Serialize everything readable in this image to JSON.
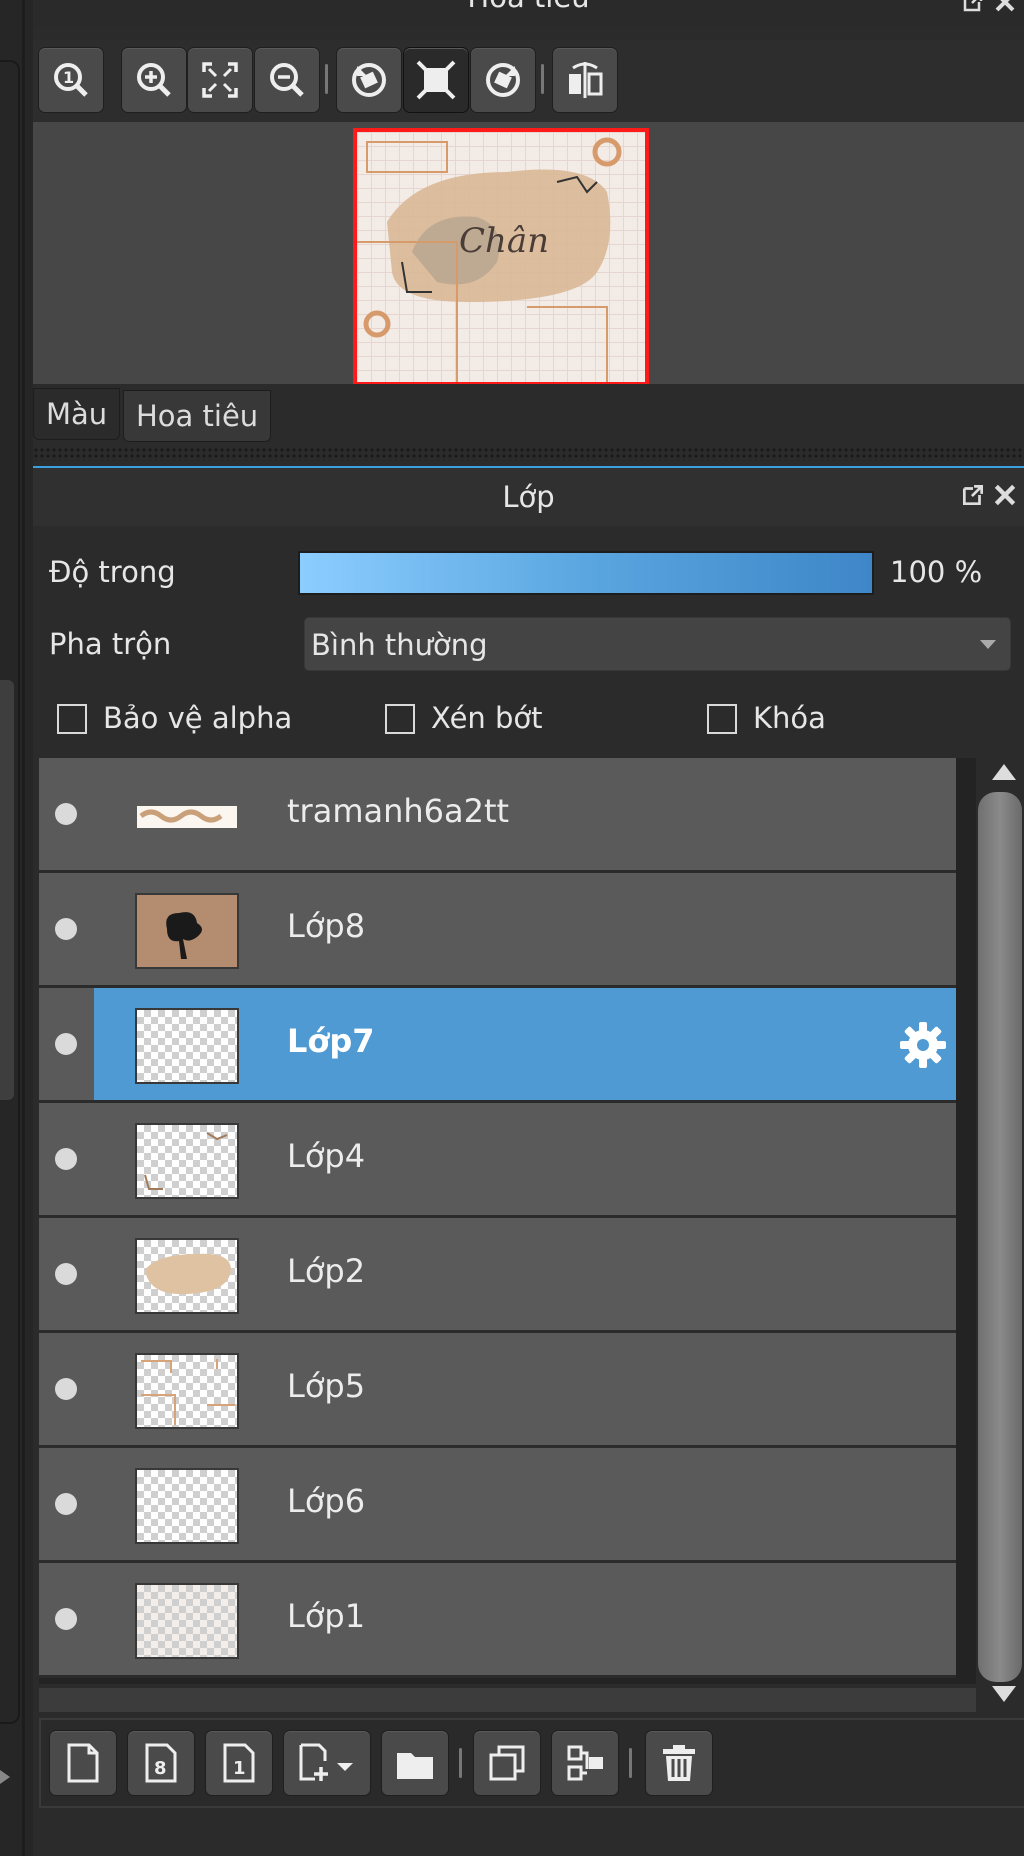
{
  "navigator": {
    "title": "Hoa tiêu",
    "tools": [
      "zoom-reset-icon",
      "zoom-in-icon",
      "fit-window-icon",
      "zoom-out-icon",
      "rotate-left-icon",
      "fit-canvas-icon",
      "rotate-right-icon",
      "flip-icon"
    ],
    "tabs": [
      {
        "label": "Màu"
      },
      {
        "label": "Hoa tiêu"
      }
    ],
    "active_tab": 1,
    "preview_text": "Chân"
  },
  "layers": {
    "title": "Lớp",
    "opacity_label": "Độ trong",
    "opacity_value": "100 %",
    "opacity_percent": 100,
    "blend_label": "Pha trộn",
    "blend_value": "Bình thường",
    "checks": [
      {
        "label": "Bảo vệ alpha",
        "checked": false
      },
      {
        "label": "Xén bớt",
        "checked": false
      },
      {
        "label": "Khóa",
        "checked": false
      }
    ],
    "items": [
      {
        "name": "tramanh6a2tt",
        "selected": false
      },
      {
        "name": "Lớp8",
        "selected": false
      },
      {
        "name": "Lớp7",
        "selected": true
      },
      {
        "name": "Lớp4",
        "selected": false
      },
      {
        "name": "Lớp2",
        "selected": false
      },
      {
        "name": "Lớp5",
        "selected": false
      },
      {
        "name": "Lớp6",
        "selected": false
      },
      {
        "name": "Lớp1",
        "selected": false
      }
    ],
    "bottom_tools": [
      "new-layer-icon",
      "new-8bit-layer-icon",
      "new-1bit-layer-icon",
      "add-layer-menu-icon",
      "folder-icon",
      "duplicate-icon",
      "merge-down-icon",
      "trash-icon"
    ]
  },
  "colors": {
    "selection": "#4f9ad3",
    "accent_line": "#3aa0e0",
    "preview_border": "#ff1a1a"
  }
}
